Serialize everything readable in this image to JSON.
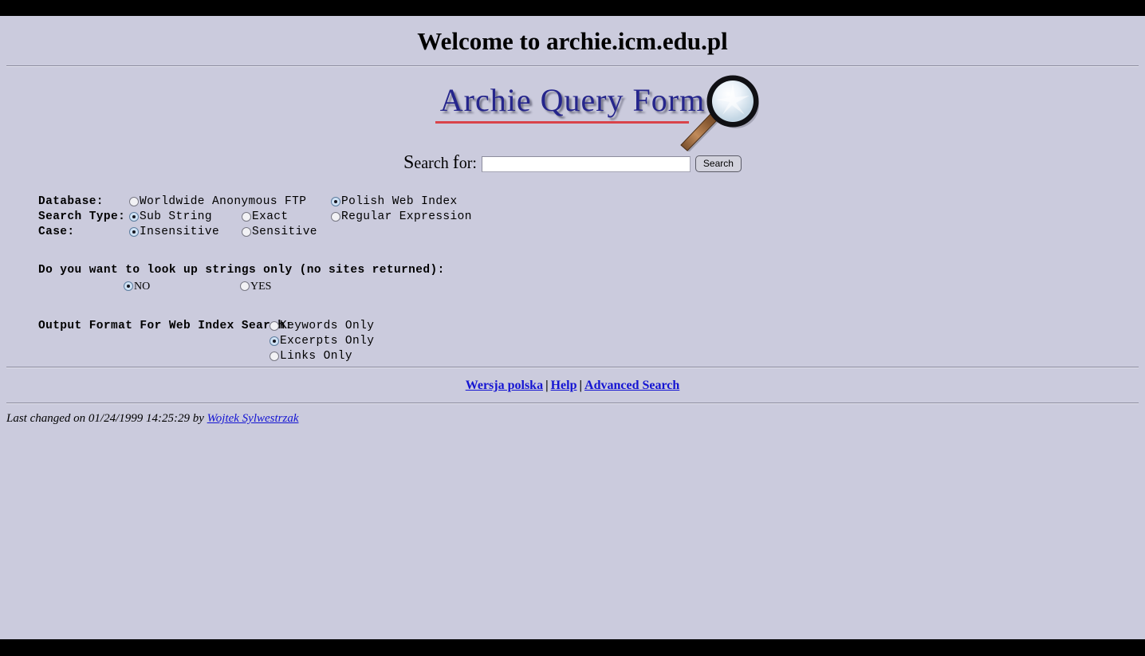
{
  "window": {
    "top_bar_color": "#000000",
    "bottom_bar_color": "#000000",
    "background_color": "#cbcbdd"
  },
  "header": {
    "title": "Welcome to archie.icm.edu.pl"
  },
  "logo": {
    "text": "Archie Query Form",
    "text_color": "#25258c",
    "underline_color": "#d9434a",
    "icon": "magnifying-glass-icon"
  },
  "search": {
    "label_cap": "S",
    "label_rest": "earch ",
    "label_cap2": "f",
    "label_rest2": "or:",
    "label_full": "Search for:",
    "value": "",
    "placeholder": "",
    "button_label": "Search"
  },
  "options": {
    "database": {
      "label": "Database:",
      "choices": [
        {
          "label": "Worldwide Anonymous FTP",
          "checked": false
        },
        {
          "label": "Polish Web Index",
          "checked": true
        }
      ]
    },
    "search_type": {
      "label": "Search Type:",
      "choices": [
        {
          "label": "Sub String",
          "checked": true
        },
        {
          "label": "Exact",
          "checked": false
        },
        {
          "label": "Regular Expression",
          "checked": false
        }
      ]
    },
    "case": {
      "label": "Case:",
      "choices": [
        {
          "label": "Insensitive",
          "checked": true
        },
        {
          "label": "Sensitive",
          "checked": false
        }
      ]
    }
  },
  "lookup": {
    "title": "Do you want to look up strings only (no sites returned):",
    "choices": [
      {
        "label": "NO",
        "checked": true
      },
      {
        "label": "YES",
        "checked": false
      }
    ]
  },
  "output_format": {
    "title": "Output Format For Web Index Search:",
    "choices": [
      {
        "label": "Keywords Only",
        "checked": false
      },
      {
        "label": "Excerpts Only",
        "checked": true
      },
      {
        "label": "Links Only",
        "checked": false
      }
    ]
  },
  "footer": {
    "links": [
      {
        "label": "Wersja polska"
      },
      {
        "label": "Help"
      },
      {
        "label": "Advanced Search"
      }
    ],
    "separator": "|",
    "last_changed_prefix": "Last changed on 01/24/1999 14:25:29 by",
    "author": "Wojtek Sylwestrzak"
  }
}
